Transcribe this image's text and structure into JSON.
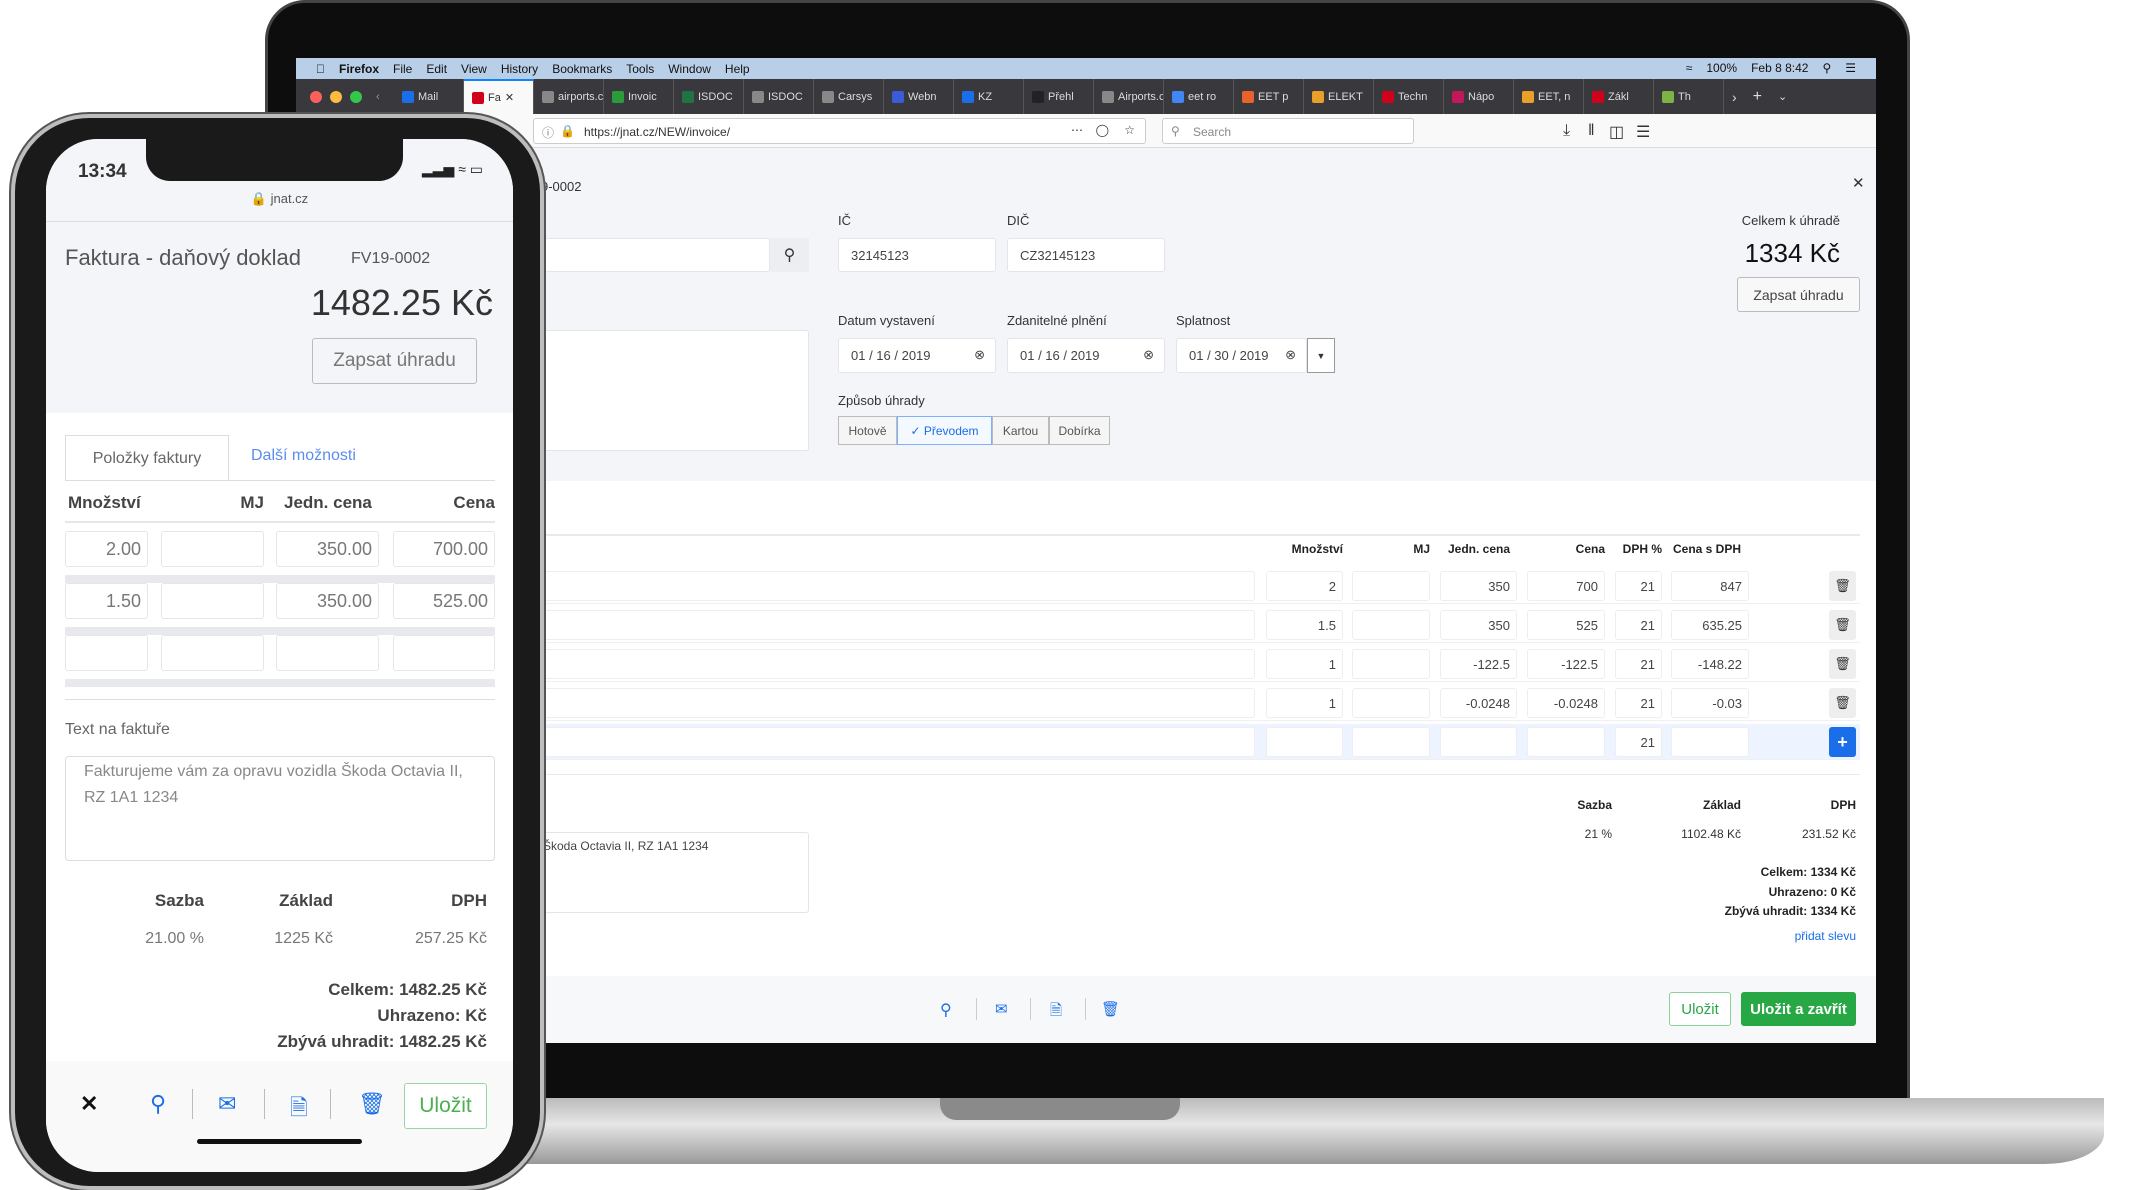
{
  "mac_menu": {
    "app": "Firefox",
    "items": [
      "File",
      "Edit",
      "View",
      "History",
      "Bookmarks",
      "Tools",
      "Window",
      "Help"
    ],
    "battery": "100%",
    "clock": "Feb 8 8:42"
  },
  "browser": {
    "tabs": [
      {
        "label": "Mail",
        "color": "#1a6fe8"
      },
      {
        "label": "Fa",
        "color": "#d0021b",
        "active": true
      },
      {
        "label": "airports.c",
        "color": "#888"
      },
      {
        "label": "Invoic",
        "color": "#2a9d3a"
      },
      {
        "label": "ISDOC",
        "color": "#217346"
      },
      {
        "label": "ISDOC",
        "color": "#888"
      },
      {
        "label": "Carsys",
        "color": "#888"
      },
      {
        "label": "Webn",
        "color": "#3b5bdb"
      },
      {
        "label": "KZ",
        "color": "#1a6fe8"
      },
      {
        "label": "Přehl",
        "color": "#222"
      },
      {
        "label": "Airports.c",
        "color": "#888"
      },
      {
        "label": "eet ro",
        "color": "#4285f4"
      },
      {
        "label": "EET p",
        "color": "#e8632b"
      },
      {
        "label": "ELEKT",
        "color": "#e8a02b"
      },
      {
        "label": "Techn",
        "color": "#d0021b"
      },
      {
        "label": "Nápo",
        "color": "#c2185b"
      },
      {
        "label": "EET, n",
        "color": "#e8a02b"
      },
      {
        "label": "Zákl",
        "color": "#d0021b"
      },
      {
        "label": "Th",
        "color": "#7cb342"
      }
    ],
    "url": "https://jnat.cz/NEW/invoice/",
    "search_placeholder": "Search"
  },
  "desktop": {
    "doc_number": "9-0002",
    "ic_label": "IČ",
    "ic_value": "32145123",
    "dic_label": "DIČ",
    "dic_value": "CZ32145123",
    "total_label": "Celkem k úhradě",
    "total_value": "1334 Kč",
    "pay_button": "Zapsat úhradu",
    "date_labels": [
      "Datum vystavení",
      "Zdanitelné plnění",
      "Splatnost"
    ],
    "dates": [
      "01 / 16 / 2019",
      "01 / 16 / 2019",
      "01 / 30 / 2019"
    ],
    "payment_label": "Způsob úhrady",
    "payment_options": [
      "Hotově",
      "Převodem",
      "Kartou",
      "Dobírka"
    ],
    "payment_selected": "Převodem",
    "table_headers": [
      "Množství",
      "MJ",
      "Jedn. cena",
      "Cena",
      "DPH %",
      "Cena s DPH"
    ],
    "rows": [
      {
        "qty": "2",
        "mj": "",
        "unit": "350",
        "price": "700",
        "vat": "21",
        "total": "847"
      },
      {
        "qty": "1.5",
        "mj": "",
        "unit": "350",
        "price": "525",
        "vat": "21",
        "total": "635.25"
      },
      {
        "qty": "1",
        "mj": "",
        "unit": "-122.5",
        "price": "-122.5",
        "vat": "21",
        "total": "-148.22"
      },
      {
        "qty": "1",
        "mj": "",
        "unit": "-0.0248",
        "price": "-0.0248",
        "vat": "21",
        "total": "-0.03"
      },
      {
        "qty": "",
        "mj": "",
        "unit": "",
        "price": "",
        "vat": "21",
        "total": ""
      }
    ],
    "invoice_text": "Škoda Octavia II, RZ 1A1 1234",
    "vat_headers": [
      "Sazba",
      "Základ",
      "DPH"
    ],
    "vat_row": [
      "21 %",
      "1102.48 Kč",
      "231.52 Kč"
    ],
    "sum_total": "Celkem: 1334 Kč",
    "sum_paid": "Uhrazeno: 0 Kč",
    "sum_remaining": "Zbývá uhradit: 1334 Kč",
    "discount_link": "přidat slevu",
    "save": "Uložit",
    "save_close": "Uložit a zavřít"
  },
  "phone": {
    "time": "13:34",
    "domain": "jnat.cz",
    "title": "Faktura - daňový doklad",
    "doc_number": "FV19-0002",
    "total": "1482.25 Kč",
    "pay_button": "Zapsat úhradu",
    "tabs": [
      "Položky faktury",
      "Další možnosti"
    ],
    "table_headers": [
      "Množství",
      "MJ",
      "Jedn. cena",
      "Cena"
    ],
    "rows": [
      [
        "2.00",
        "",
        "350.00",
        "700.00"
      ],
      [
        "1.50",
        "",
        "350.00",
        "525.00"
      ],
      [
        "",
        "",
        "",
        ""
      ]
    ],
    "text_label": "Text na faktuře",
    "text_value": "Fakturujeme vám za opravu vozidla Škoda Octavia II, RZ 1A1 1234",
    "vat_headers": [
      "Sazba",
      "Základ",
      "DPH"
    ],
    "vat_row": [
      "21.00 %",
      "1225 Kč",
      "257.25 Kč"
    ],
    "sum_total": "Celkem: 1482.25 Kč",
    "sum_paid": "Uhrazeno: Kč",
    "sum_remaining": "Zbývá uhradit: 1482.25 Kč",
    "save": "Uložit"
  },
  "colors": {
    "accent": "#1a6fe8",
    "success": "#28a745",
    "selected_tab_bar": "#0a84ff"
  }
}
